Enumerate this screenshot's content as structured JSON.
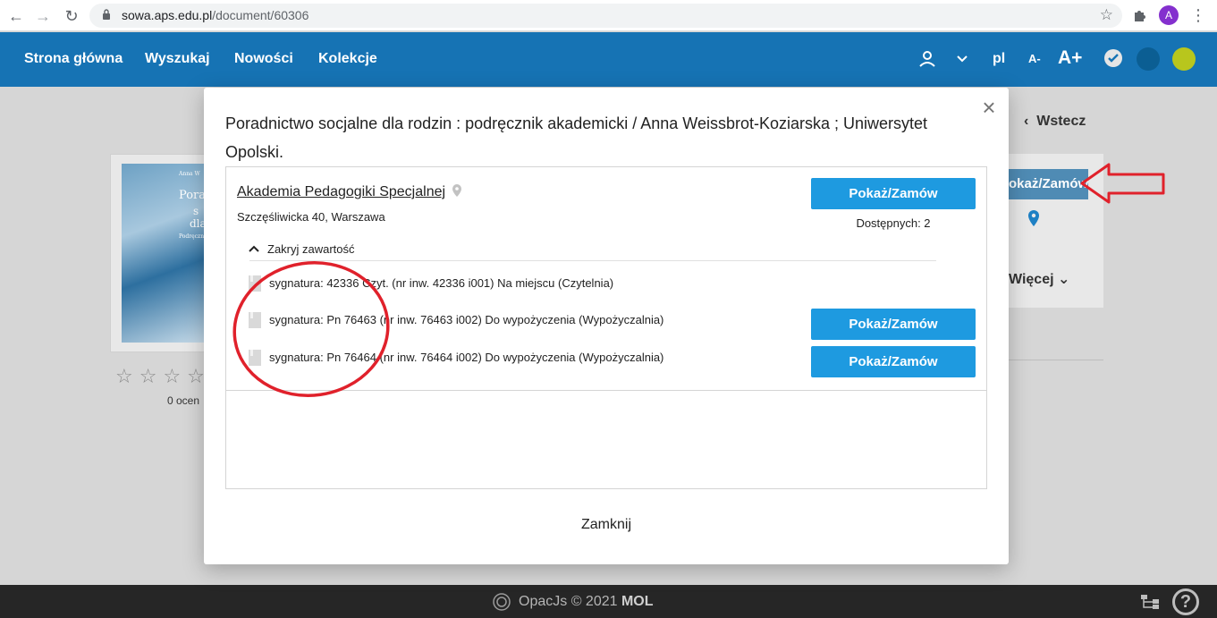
{
  "browser": {
    "url_host": "sowa.aps.edu.pl",
    "url_path": "/document/60306",
    "avatar_letter": "A"
  },
  "header": {
    "nav": [
      "Strona główna",
      "Wyszukaj",
      "Nowości",
      "Kolekcje"
    ],
    "lang": "pl",
    "font_smaller": "A-",
    "font_larger": "A+",
    "colors": {
      "bar": "#1673b4",
      "dark_circle": "#0b5e93",
      "lime_circle": "#b8c61d"
    }
  },
  "background": {
    "cover_lines": [
      "Anna W",
      "Porad",
      "s",
      "dla",
      "Podręczni"
    ],
    "ratings_count": "0 ocen",
    "back_label": "Wstecz",
    "order_label": "Pokaż/Zamów",
    "more_label": "Więcej"
  },
  "modal": {
    "title": "Poradnictwo socjalne dla rodzin : podręcznik akademicki / Anna Weissbrot-Koziarska ; Uniwersytet Opolski.",
    "library_name": "Akademia Pedagogiki Specjalnej",
    "library_address": "Szczęśliwicka 40, Warszawa",
    "order_label": "Pokaż/Zamów",
    "available": "Dostępnych: 2",
    "toggle_label": "Zakryj zawartość",
    "items": [
      {
        "text": "sygnatura: 42336 Czyt. (nr inw. 42336 i001) Na miejscu (Czytelnia)",
        "orderable": false
      },
      {
        "text": "sygnatura: Pn 76463 (nr inw. 76463 i002) Do wypożyczenia (Wypożyczalnia)",
        "orderable": true
      },
      {
        "text": "sygnatura: Pn 76464 (nr inw. 76464 i002) Do wypożyczenia (Wypożyczalnia)",
        "orderable": true
      }
    ],
    "close_label": "Zamknij",
    "accent": "#1e9ae0"
  },
  "footer": {
    "text": "OpacJs © 2021",
    "brand": "MOL",
    "help": "?"
  },
  "annotations": {
    "color": "#e0212b"
  }
}
